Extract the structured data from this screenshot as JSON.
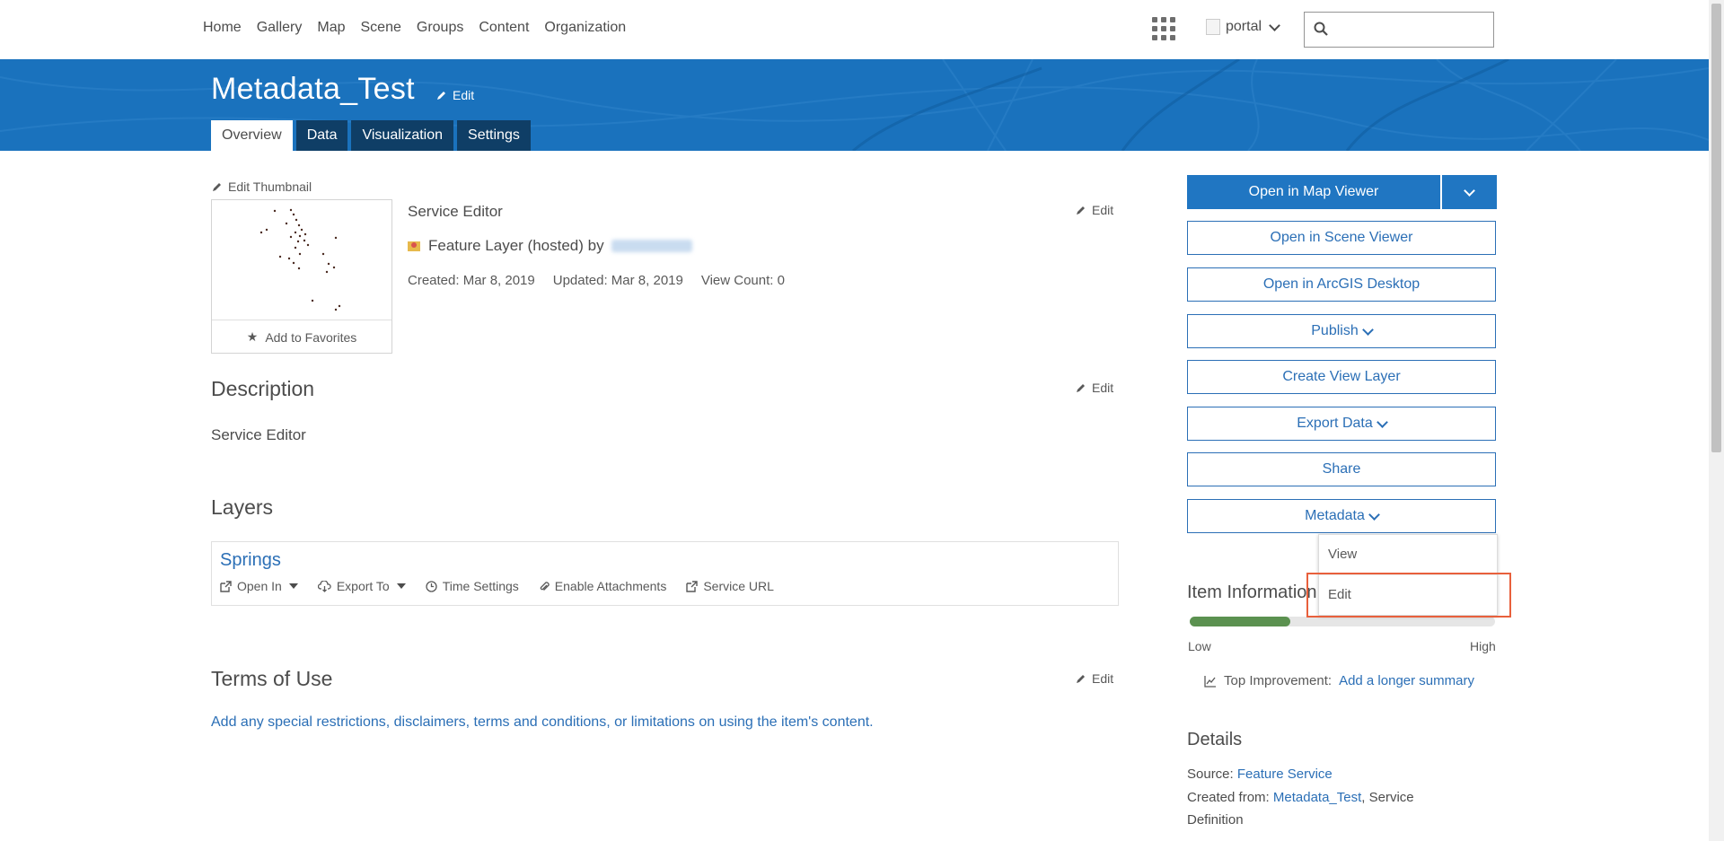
{
  "nav": {
    "links": [
      "Home",
      "Gallery",
      "Map",
      "Scene",
      "Groups",
      "Content",
      "Organization"
    ],
    "user": "portal",
    "search_placeholder": ""
  },
  "item": {
    "title": "Metadata_Test",
    "title_edit": "Edit",
    "tabs": [
      "Overview",
      "Data",
      "Visualization",
      "Settings"
    ],
    "active_tab": "Overview"
  },
  "overview": {
    "edit_thumbnail": "Edit Thumbnail",
    "add_to_favorites": "Add to Favorites",
    "summary": "Service Editor",
    "summary_edit": "Edit",
    "item_type": "Feature Layer (hosted) by",
    "created": "Created: Mar 8, 2019",
    "updated": "Updated: Mar 8, 2019",
    "view_count": "View Count: 0"
  },
  "description": {
    "heading": "Description",
    "edit": "Edit",
    "text": "Service Editor"
  },
  "layers": {
    "heading": "Layers",
    "items": [
      {
        "name": "Springs",
        "actions": {
          "open_in": "Open In",
          "export_to": "Export To",
          "time_settings": "Time Settings",
          "enable_attachments": "Enable Attachments",
          "service_url": "Service URL"
        }
      }
    ]
  },
  "terms": {
    "heading": "Terms of Use",
    "edit": "Edit",
    "placeholder": "Add any special restrictions, disclaimers, terms and conditions, or limitations on using the item's content."
  },
  "sidebar": {
    "open_map_viewer": "Open in Map Viewer",
    "open_scene_viewer": "Open in Scene Viewer",
    "open_desktop": "Open in ArcGIS Desktop",
    "publish": "Publish",
    "create_view_layer": "Create View Layer",
    "export_data": "Export Data",
    "share": "Share",
    "metadata": "Metadata",
    "metadata_menu": [
      "View",
      "Edit"
    ],
    "item_information": "Item Information",
    "info_level": 0.33,
    "low": "Low",
    "high": "High",
    "top_improvement_label": "Top Improvement:",
    "top_improvement_link": "Add a longer summary",
    "details_heading": "Details",
    "source_label": "Source:",
    "source_value": "Feature Service",
    "created_from_label": "Created from:",
    "created_from_link": "Metadata_Test",
    "created_from_rest": ", Service",
    "created_from_line2": "Definition"
  },
  "colors": {
    "brand_blue": "#1a72bd",
    "link_blue": "#2b6fb6",
    "tab_dark": "#0f3e66",
    "meter_green": "#5b9150",
    "highlight": "#e8603c"
  }
}
